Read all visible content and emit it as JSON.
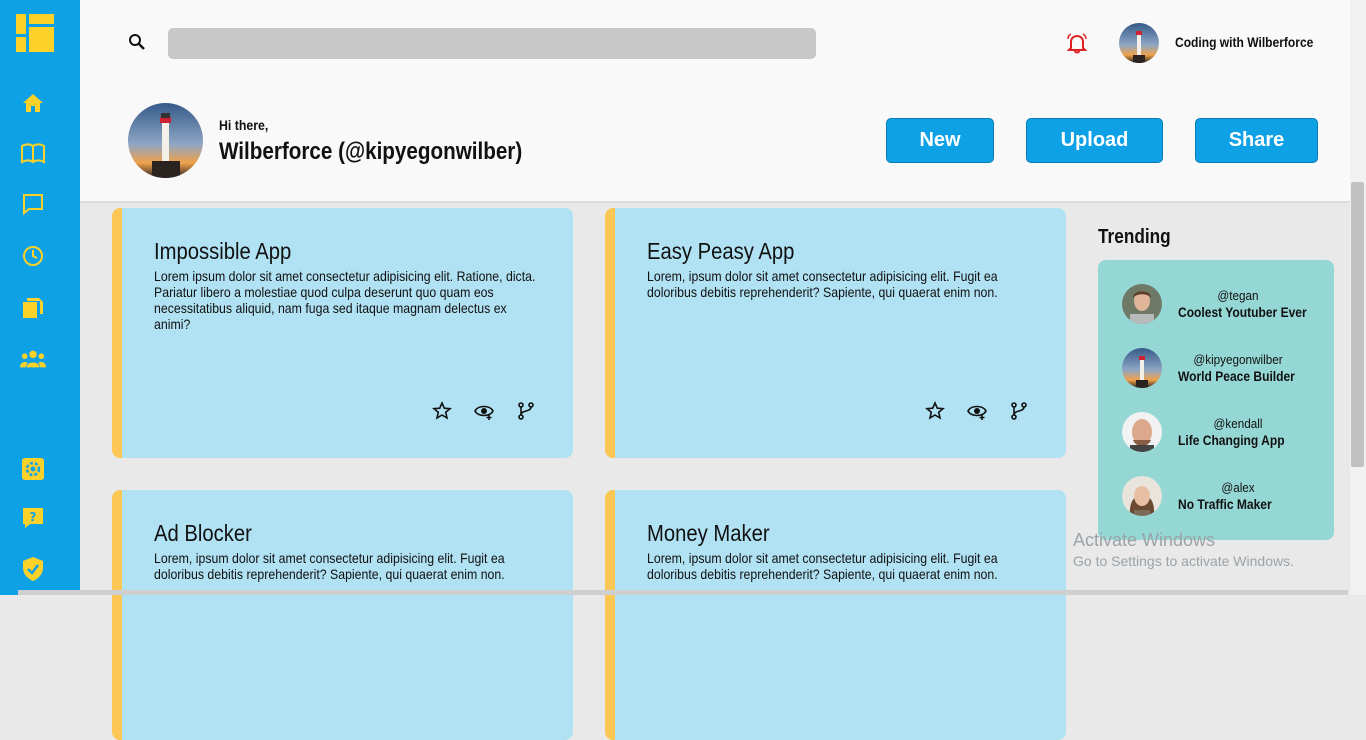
{
  "header": {
    "search_placeholder": "",
    "user_name": "Coding with Wilberforce"
  },
  "profile": {
    "greeting": "Hi there,",
    "name": "Wilberforce (@kipyegonwilber)"
  },
  "actions": {
    "new_label": "New",
    "upload_label": "Upload",
    "share_label": "Share"
  },
  "sidebar": {
    "icons": [
      "dashboard-icon",
      "home-icon",
      "book-icon",
      "message-icon",
      "clock-icon",
      "documents-icon",
      "group-icon",
      "settings-icon",
      "help-icon",
      "shield-icon"
    ]
  },
  "cards": [
    {
      "title": "Impossible App",
      "body": "Lorem ipsum dolor sit amet consectetur adipisicing elit. Ratione, dicta. Pariatur libero a molestiae quod culpa deserunt quo quam eos necessitatibus aliquid, nam fuga sed itaque magnam delectus ex animi?"
    },
    {
      "title": "Easy Peasy App",
      "body": "Lorem, ipsum dolor sit amet consectetur adipisicing elit. Fugit ea doloribus debitis reprehenderit? Sapiente, qui quaerat enim non."
    },
    {
      "title": "Ad Blocker",
      "body": "Lorem, ipsum dolor sit amet consectetur adipisicing elit. Fugit ea doloribus debitis reprehenderit? Sapiente, qui quaerat enim non."
    },
    {
      "title": "Money Maker",
      "body": "Lorem, ipsum dolor sit amet consectetur adipisicing elit. Fugit ea doloribus debitis reprehenderit? Sapiente, qui quaerat enim non."
    }
  ],
  "trending": {
    "title": "Trending",
    "items": [
      {
        "handle": "@tegan",
        "desc": "Coolest Youtuber Ever"
      },
      {
        "handle": "@kipyegonwilber",
        "desc": "World Peace Builder"
      },
      {
        "handle": "@kendall",
        "desc": "Life Changing App"
      },
      {
        "handle": "@alex",
        "desc": "No Traffic Maker"
      }
    ]
  },
  "watermark": {
    "line1": "Activate Windows",
    "line2": "Go to Settings to activate Windows."
  },
  "colors": {
    "sidebar": "#0fa1e6",
    "accent_yellow": "#fcc755",
    "card": "#b1e2f3",
    "trending_bg": "#95d7d5",
    "bell": "#e02020"
  }
}
